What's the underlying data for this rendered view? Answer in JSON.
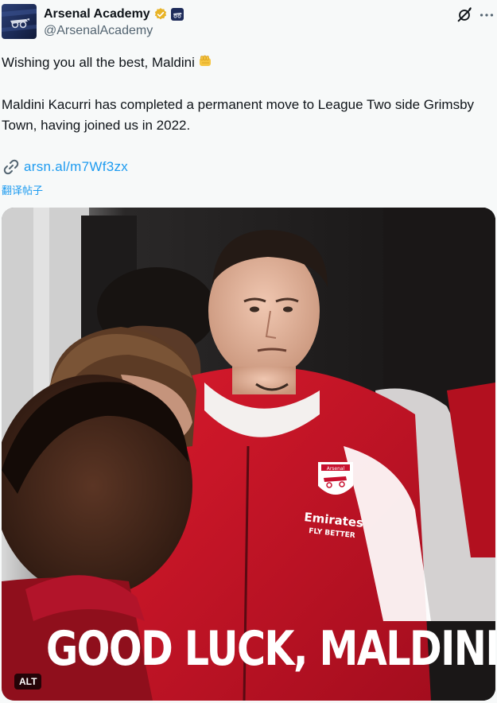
{
  "account": {
    "display_name": "Arsenal Academy",
    "handle": "@ArsenalAcademy",
    "verified_badge_color": "#e8b326",
    "affiliate_badge": "arsenal-crest-icon"
  },
  "actions": {
    "grok_icon": "grok-icon",
    "more_icon": "more-icon"
  },
  "tweet": {
    "line1": "Wishing you all the best, Maldini",
    "line1_emoji": "oncoming-fist-icon",
    "line2": "Maldini Kacurri has completed a permanent move to League Two side Grimsby Town, having joined us in 2022.",
    "link": "arsn.al/m7Wf3zx",
    "translate": "翻译帖子"
  },
  "media": {
    "overlay_title": "GOOD LUCK, MALDINI",
    "alt_badge": "ALT",
    "shirt_sponsor": "Emirates",
    "shirt_sponsor_tag": "FLY BETTER",
    "crest_text": "Arsenal"
  },
  "colors": {
    "link": "#1d9bf0",
    "text": "#0f1419",
    "secondary_text": "#536471",
    "background": "#f7f9f9",
    "jersey_red": "#c8102e"
  }
}
